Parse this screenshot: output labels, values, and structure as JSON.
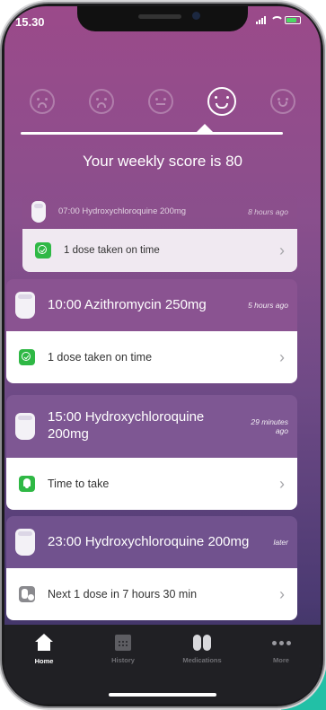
{
  "status_bar": {
    "time": "15.30"
  },
  "moods": [
    {
      "name": "very-sad-face-icon",
      "mouth": "sad",
      "selected": false
    },
    {
      "name": "sad-face-icon",
      "mouth": "sad",
      "selected": false
    },
    {
      "name": "neutral-face-icon",
      "mouth": "flat",
      "selected": false
    },
    {
      "name": "happy-face-icon",
      "mouth": "smile",
      "selected": true
    },
    {
      "name": "very-happy-face-icon",
      "mouth": "smile",
      "selected": false
    }
  ],
  "score": {
    "text": "Your weekly score is 80"
  },
  "cards": [
    {
      "title": "07:00 Hydroxychloroquine 200mg",
      "time": "8 hours ago",
      "status_icon": "check-icon",
      "message": "1 dose taken on time"
    },
    {
      "title": "10:00 Azithromycin 250mg",
      "time": "5 hours ago",
      "status_icon": "check-icon",
      "message": "1 dose taken on time"
    },
    {
      "title": "15:00 Hydroxychloroquine 200mg",
      "time": "29 minutes ago",
      "status_icon": "bell-icon",
      "message": "Time to take"
    },
    {
      "title": "23:00 Hydroxychloroquine 200mg",
      "time": "later",
      "status_icon": "pill-clock-icon",
      "message": "Next 1 dose in 7 hours 30 min"
    }
  ],
  "tabs": [
    {
      "label": "Home",
      "icon": "home-icon",
      "active": true
    },
    {
      "label": "History",
      "icon": "calendar-icon",
      "active": false
    },
    {
      "label": "Medications",
      "icon": "medications-icon",
      "active": false
    },
    {
      "label": "More",
      "icon": "more-icon",
      "active": false
    }
  ],
  "colors": {
    "accent_green": "#2fb845",
    "teal": "#22c0a6",
    "tab_bar": "#202024"
  }
}
